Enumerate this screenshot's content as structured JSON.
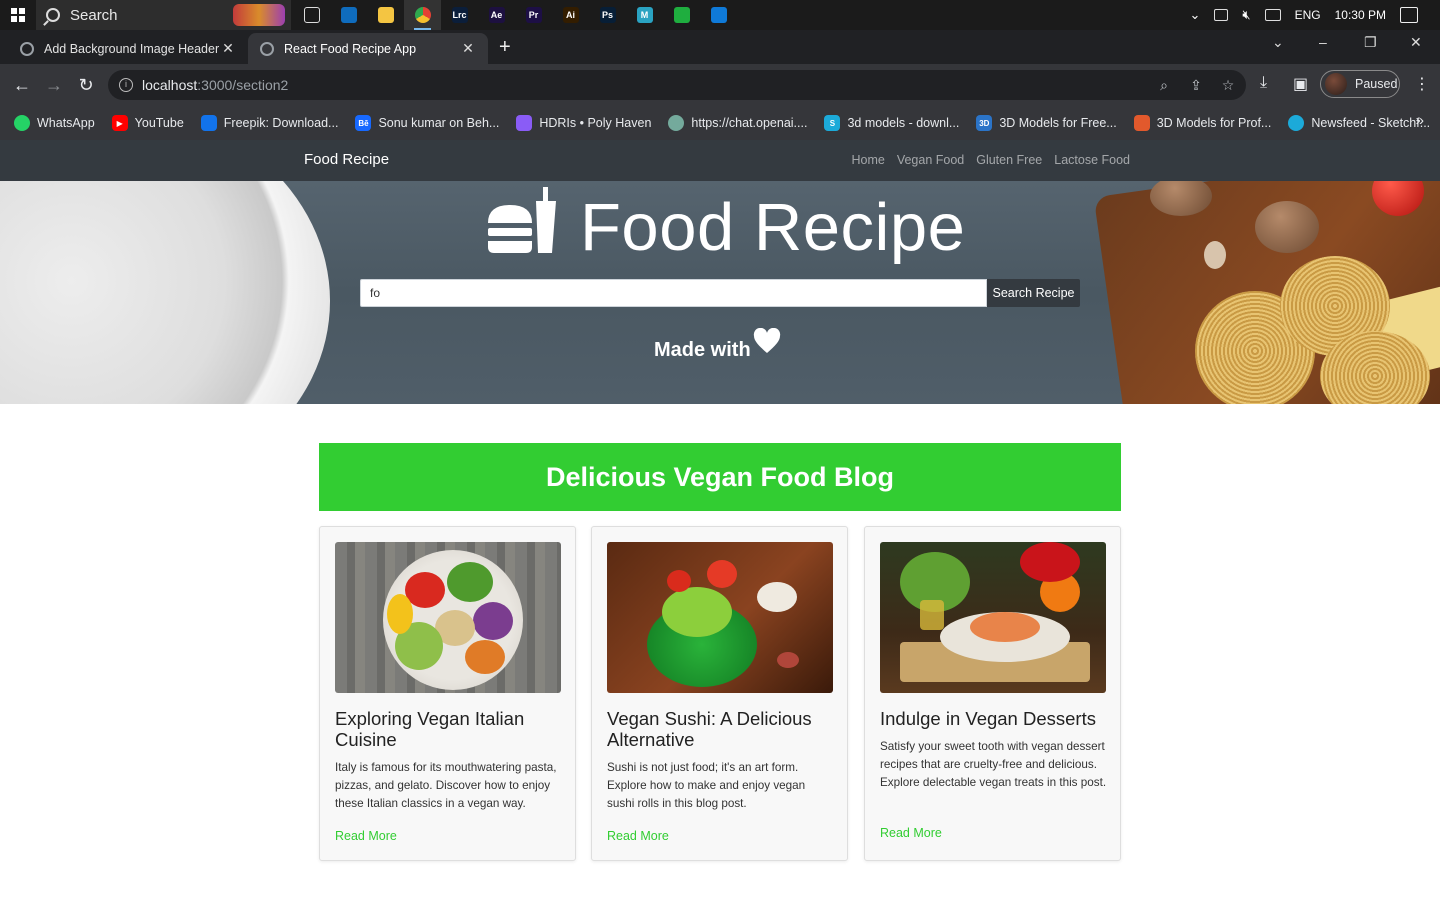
{
  "taskbar": {
    "search_label": "Search",
    "language": "ENG",
    "time": "10:30 PM",
    "apps": [
      {
        "name": "task-view",
        "label": "",
        "color": "#1b1b1b"
      },
      {
        "name": "outlook",
        "label": "",
        "color": "#0f6cbd"
      },
      {
        "name": "file-explorer",
        "label": "",
        "color": "#f4c542"
      },
      {
        "name": "chrome",
        "label": "",
        "color": "#e44134"
      },
      {
        "name": "lightroom-classic",
        "label": "Lrc",
        "color": "#0b1e3a"
      },
      {
        "name": "after-effects",
        "label": "Ae",
        "color": "#1d1040"
      },
      {
        "name": "premiere-pro",
        "label": "Pr",
        "color": "#1d0f45"
      },
      {
        "name": "illustrator",
        "label": "Ai",
        "color": "#331d00"
      },
      {
        "name": "photoshop",
        "label": "Ps",
        "color": "#071e36"
      },
      {
        "name": "markdown-app",
        "label": "M",
        "color": "#2aa3c2"
      },
      {
        "name": "green-app",
        "label": "",
        "color": "#1fae3f"
      },
      {
        "name": "vscode",
        "label": "",
        "color": "#0f7ad8"
      }
    ]
  },
  "browser": {
    "tabs": [
      {
        "title": "Add Background Image Header"
      },
      {
        "title": "React Food Recipe App"
      }
    ],
    "url_host": "localhost",
    "url_rest": ":3000/section2",
    "profile_status": "Paused",
    "bookmarks": [
      {
        "label": "WhatsApp",
        "icon": "whatsapp-icon",
        "color": "#25d366",
        "glyph": ""
      },
      {
        "label": "YouTube",
        "icon": "youtube-icon",
        "color": "#ff0000",
        "glyph": "▶"
      },
      {
        "label": "Freepik: Download...",
        "icon": "freepik-icon",
        "color": "#1273eb",
        "glyph": ""
      },
      {
        "label": "Sonu kumar on Beh...",
        "icon": "behance-icon",
        "color": "#1769ff",
        "glyph": "Bē"
      },
      {
        "label": "HDRIs • Poly Haven",
        "icon": "polyhaven-icon",
        "color": "#8a5cf6",
        "glyph": ""
      },
      {
        "label": "https://chat.openai....",
        "icon": "openai-icon",
        "color": "#74aa9c",
        "glyph": ""
      },
      {
        "label": "3d models - downl...",
        "icon": "sketchfab-s-icon",
        "color": "#1caad9",
        "glyph": "S"
      },
      {
        "label": "3D Models for Free...",
        "icon": "free3d-icon",
        "color": "#2b74c8",
        "glyph": "3D"
      },
      {
        "label": "3D Models for Prof...",
        "icon": "turbosquid-icon",
        "color": "#e2592c",
        "glyph": ""
      },
      {
        "label": "Newsfeed - Sketchf...",
        "icon": "sketchfab-icon",
        "color": "#1caad9",
        "glyph": ""
      }
    ]
  },
  "site": {
    "brand": "Food Recipe",
    "nav": [
      "Home",
      "Vegan Food",
      "Gluten Free",
      "Lactose Food"
    ],
    "hero_title": "Food Recipe",
    "search_value": "fo",
    "search_button": "Search Recipe",
    "made_with": "Made with"
  },
  "blog": {
    "heading": "Delicious Vegan Food Blog",
    "cards": [
      {
        "title": "Exploring Vegan Italian Cuisine",
        "text": "Italy is famous for its mouthwatering pasta, pizzas, and gelato. Discover how to enjoy these Italian classics in a vegan way.",
        "link": "Read More"
      },
      {
        "title": "Vegan Sushi: A Delicious Alternative",
        "text": "Sushi is not just food; it's an art form. Explore how to make and enjoy vegan sushi rolls in this blog post.",
        "link": "Read More"
      },
      {
        "title": "Indulge in Vegan Desserts",
        "text": "Satisfy your sweet tooth with vegan dessert recipes that are cruelty-free and delicious. Explore delectable vegan treats in this post.",
        "link": "Read More"
      }
    ]
  },
  "colors": {
    "accent_green": "#32cd32",
    "navbar_dark": "#343a40"
  }
}
